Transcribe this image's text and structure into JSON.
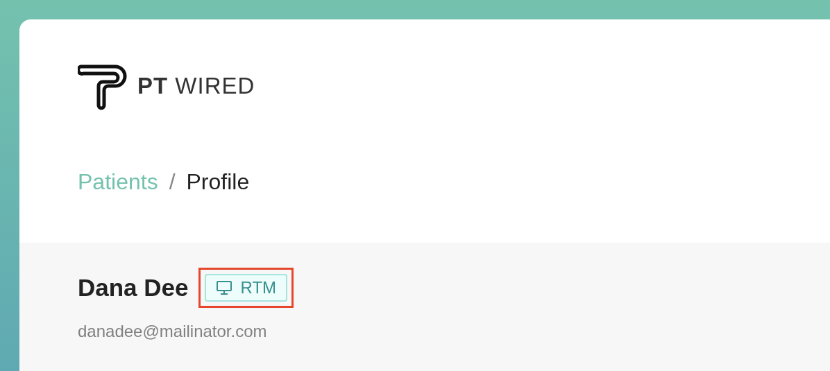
{
  "logo": {
    "text": "**PT** WIRED"
  },
  "breadcrumb": [
    {
      "label": "Patients",
      "kind": "link"
    },
    {
      "label": "/",
      "kind": "separator"
    },
    {
      "label": "Profile",
      "kind": "current"
    }
  ],
  "patient": {
    "name": "Dana Dee",
    "badge": {
      "label": "RTM",
      "highlighted": true
    },
    "email": "danadee@mailinator.com"
  }
}
